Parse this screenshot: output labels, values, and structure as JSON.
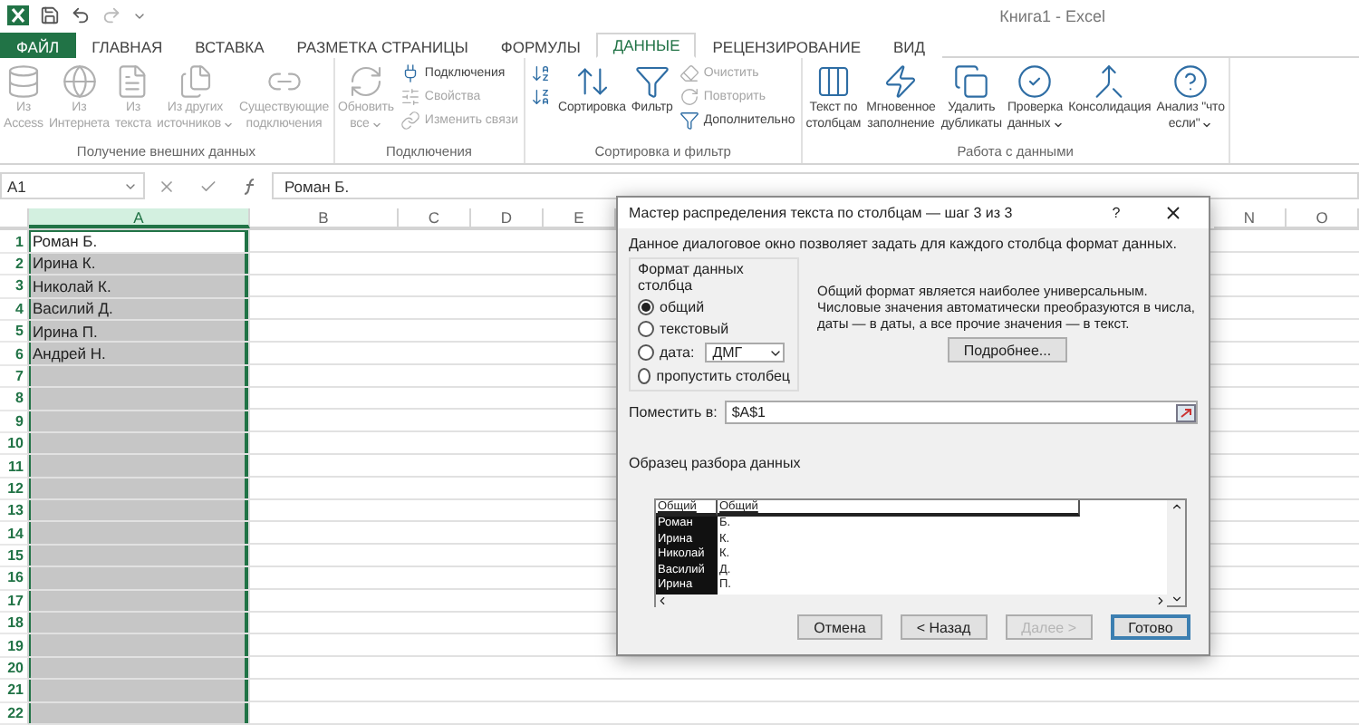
{
  "window": {
    "title": "Книга1 - Excel"
  },
  "tabs": [
    {
      "label": "ФАЙЛ",
      "kind": "file",
      "selected": false
    },
    {
      "label": "ГЛАВНАЯ",
      "kind": "tab",
      "selected": false
    },
    {
      "label": "ВСТАВКА",
      "kind": "tab",
      "selected": false
    },
    {
      "label": "РАЗМЕТКА СТРАНИЦЫ",
      "kind": "tab",
      "selected": false
    },
    {
      "label": "ФОРМУЛЫ",
      "kind": "tab",
      "selected": false
    },
    {
      "label": "ДАННЫЕ",
      "kind": "tab",
      "selected": true
    },
    {
      "label": "РЕЦЕНЗИРОВАНИЕ",
      "kind": "tab",
      "selected": false
    },
    {
      "label": "ВИД",
      "kind": "tab",
      "selected": false
    }
  ],
  "ribbon": {
    "groups": [
      {
        "label": "Получение внешних данных",
        "items": [
          {
            "kind": "large",
            "lines": [
              "Из",
              "Access"
            ],
            "disabled": true,
            "dropdown": false
          },
          {
            "kind": "large",
            "lines": [
              "Из",
              "Интернета"
            ],
            "disabled": true,
            "dropdown": false
          },
          {
            "kind": "large",
            "lines": [
              "Из",
              "текста"
            ],
            "disabled": true,
            "dropdown": false
          },
          {
            "kind": "large",
            "lines": [
              "Из других",
              "источников"
            ],
            "disabled": true,
            "dropdown": true
          },
          {
            "kind": "large",
            "lines": [
              "Существующие",
              "подключения"
            ],
            "disabled": true,
            "dropdown": false
          }
        ]
      },
      {
        "label": "Подключения",
        "items": [
          {
            "kind": "large",
            "lines": [
              "Обновить",
              "все"
            ],
            "disabled": true,
            "dropdown": true
          },
          {
            "kind": "stack",
            "items": [
              {
                "label": "Подключения",
                "disabled": false
              },
              {
                "label": "Свойства",
                "disabled": true
              },
              {
                "label": "Изменить связи",
                "disabled": true
              }
            ]
          }
        ]
      },
      {
        "label": "Сортировка и фильтр",
        "items": [
          {
            "kind": "stack",
            "items": [
              {
                "disabled": false
              },
              {
                "disabled": false
              }
            ]
          },
          {
            "kind": "large",
            "lines": [
              "Сортировка"
            ],
            "disabled": false,
            "dropdown": false
          },
          {
            "kind": "large",
            "lines": [
              "Фильтр"
            ],
            "disabled": false,
            "dropdown": false
          },
          {
            "kind": "stack",
            "items": [
              {
                "label": "Очистить",
                "disabled": true
              },
              {
                "label": "Повторить",
                "disabled": true
              },
              {
                "label": "Дополнительно",
                "disabled": false
              }
            ]
          }
        ]
      },
      {
        "label": "Работа с данными",
        "items": [
          {
            "kind": "large",
            "lines": [
              "Текст по",
              "столбцам"
            ],
            "disabled": false,
            "dropdown": false
          },
          {
            "kind": "large",
            "lines": [
              "Мгновенное",
              "заполнение"
            ],
            "disabled": false,
            "dropdown": false
          },
          {
            "kind": "large",
            "lines": [
              "Удалить",
              "дубликаты"
            ],
            "disabled": false,
            "dropdown": false
          },
          {
            "kind": "large",
            "lines": [
              "Проверка",
              "данных"
            ],
            "disabled": false,
            "dropdown": true
          },
          {
            "kind": "large",
            "lines": [
              "Консолидация"
            ],
            "disabled": false,
            "dropdown": false
          },
          {
            "kind": "large",
            "lines": [
              "Анализ \"что",
              "если\""
            ],
            "disabled": false,
            "dropdown": true
          }
        ]
      }
    ]
  },
  "formula_bar": {
    "name_box": "A1",
    "value": "Роман Б."
  },
  "sheet": {
    "columns": [
      {
        "label": "A",
        "selected": true
      },
      {
        "label": "B",
        "selected": false
      },
      {
        "label": "C",
        "selected": false
      },
      {
        "label": "D",
        "selected": false
      },
      {
        "label": "E",
        "selected": false
      },
      {
        "label": "N",
        "selected": false
      },
      {
        "label": "O",
        "selected": false
      }
    ],
    "rows": [
      {
        "number": "1",
        "value": "Роман Б.",
        "active": true
      },
      {
        "number": "2",
        "value": "Ирина К.",
        "active": false
      },
      {
        "number": "3",
        "value": "Николай К.",
        "active": false
      },
      {
        "number": "4",
        "value": "Василий Д.",
        "active": false
      },
      {
        "number": "5",
        "value": "Ирина П.",
        "active": false
      },
      {
        "number": "6",
        "value": "Андрей Н.",
        "active": false
      },
      {
        "number": "7",
        "active": false
      },
      {
        "number": "8",
        "active": false
      },
      {
        "number": "9",
        "active": false
      },
      {
        "number": "10",
        "active": false
      },
      {
        "number": "11",
        "active": false
      },
      {
        "number": "12",
        "active": false
      },
      {
        "number": "13",
        "active": false
      },
      {
        "number": "14",
        "active": false
      },
      {
        "number": "15",
        "active": false
      },
      {
        "number": "16",
        "active": false
      },
      {
        "number": "17",
        "active": false
      },
      {
        "number": "18",
        "active": false
      },
      {
        "number": "19",
        "active": false
      },
      {
        "number": "20",
        "active": false
      },
      {
        "number": "21",
        "active": false
      },
      {
        "number": "22",
        "active": false
      }
    ]
  },
  "dialog": {
    "title": "Мастер распределения текста по столбцам — шаг 3 из 3",
    "help": "?",
    "description": "Данное диалоговое окно позволяет задать для каждого столбца формат данных.",
    "format_group": {
      "label": "Формат данных столбца",
      "options": [
        {
          "kind": "plain",
          "label": "общий",
          "selected": true
        },
        {
          "kind": "plain",
          "label": "текстовый",
          "selected": false
        },
        {
          "kind": "date",
          "label": "дата:",
          "value": "ДМГ",
          "selected": false
        },
        {
          "kind": "plain",
          "label": "пропустить столбец",
          "selected": false
        }
      ]
    },
    "info": "Общий формат является наиболее универсальным. Числовые значения автоматически преобразуются в числа, даты — в даты, а все прочие значения — в текст.",
    "details_button": "Подробнее...",
    "destination": {
      "label": "Поместить в:",
      "value": "$A$1"
    },
    "preview": {
      "label": "Образец разбора данных",
      "columns": [
        {
          "header": "Общий",
          "selected": true,
          "values": [
            "Роман",
            "Ирина",
            "Николай",
            "Василий",
            "Ирина"
          ]
        },
        {
          "header": "Общий",
          "selected": false,
          "values": [
            "Б.",
            "К.",
            "К.",
            "Д.",
            "П."
          ]
        }
      ]
    },
    "buttons": [
      {
        "label": "Отмена",
        "disabled": false,
        "default": false
      },
      {
        "label": "< Назад",
        "disabled": false,
        "default": false
      },
      {
        "label": "Далее >",
        "disabled": true,
        "default": false
      },
      {
        "label": "Готово",
        "disabled": false,
        "default": true
      }
    ]
  }
}
